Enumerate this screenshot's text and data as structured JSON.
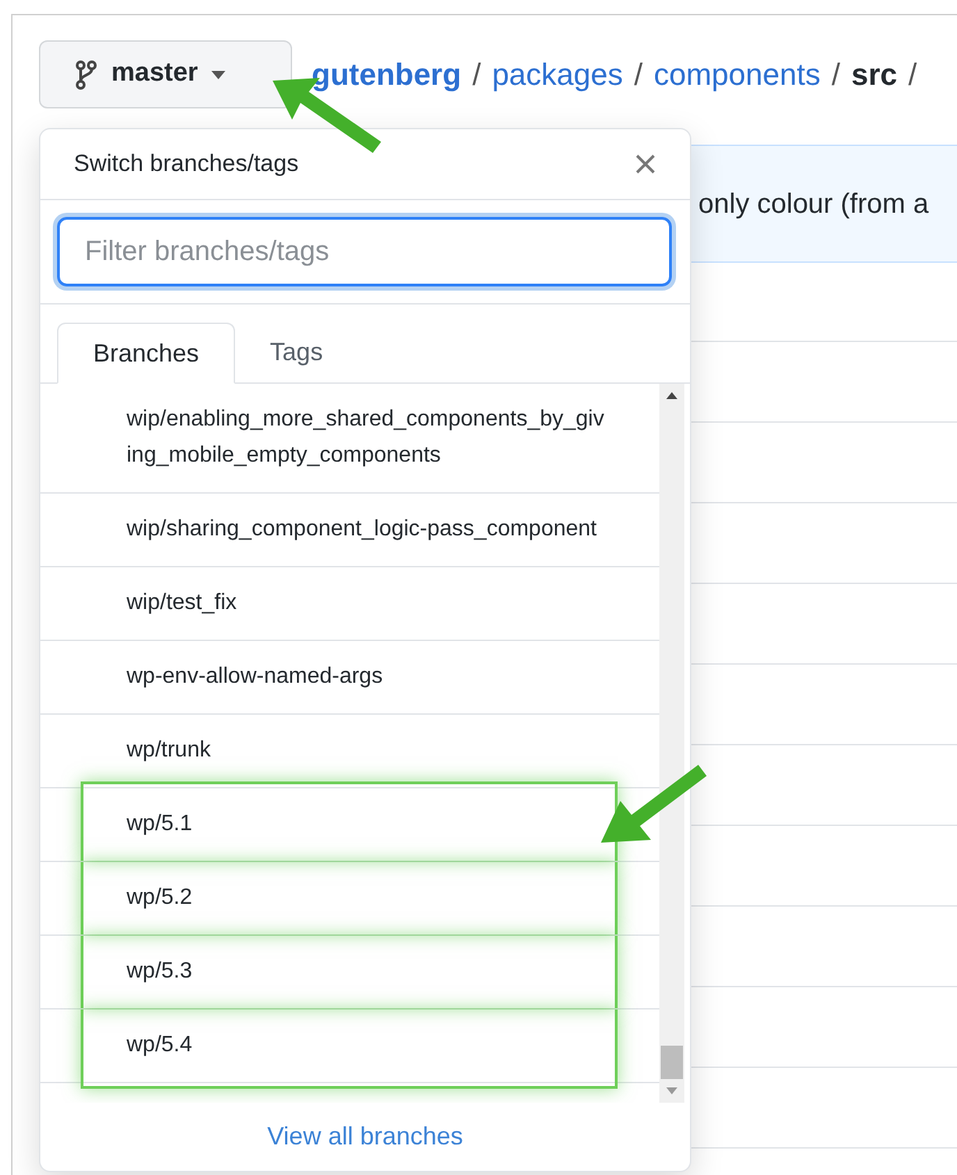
{
  "branch_button": {
    "label": "master"
  },
  "breadcrumb": [
    {
      "text": "gutenberg",
      "kind": "repo"
    },
    {
      "text": "/",
      "kind": "sep"
    },
    {
      "text": "packages",
      "kind": "link"
    },
    {
      "text": "/",
      "kind": "sep"
    },
    {
      "text": "components",
      "kind": "link"
    },
    {
      "text": "/",
      "kind": "sep"
    },
    {
      "text": "src",
      "kind": "current"
    },
    {
      "text": "/",
      "kind": "sep"
    }
  ],
  "banner": {
    "text": "only colour (from a"
  },
  "dropdown": {
    "title": "Switch branches/tags",
    "filter": {
      "placeholder": "Filter branches/tags"
    },
    "tabs": [
      {
        "label": "Branches",
        "selected": true
      },
      {
        "label": "Tags",
        "selected": false
      }
    ],
    "branches": [
      {
        "name": "wip/enabling_more_shared_components_by_giving_mobile_empty_components",
        "highlighted": false
      },
      {
        "name": "wip/sharing_component_logic-pass_component",
        "highlighted": false
      },
      {
        "name": "wip/test_fix",
        "highlighted": false
      },
      {
        "name": "wp-env-allow-named-args",
        "highlighted": false
      },
      {
        "name": "wp/trunk",
        "highlighted": false
      },
      {
        "name": "wp/5.1",
        "highlighted": true
      },
      {
        "name": "wp/5.2",
        "highlighted": true
      },
      {
        "name": "wp/5.3",
        "highlighted": true
      },
      {
        "name": "wp/5.4",
        "highlighted": true
      }
    ],
    "footer_link": "View all branches"
  }
}
